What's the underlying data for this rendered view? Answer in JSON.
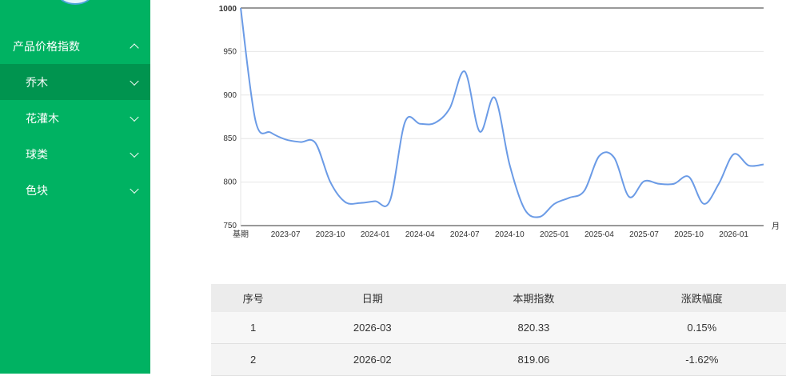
{
  "sidebar": {
    "top_item": "产品价格指数",
    "items": [
      {
        "label": "乔木"
      },
      {
        "label": "花灌木"
      },
      {
        "label": "球类"
      },
      {
        "label": "色块"
      }
    ]
  },
  "colors": {
    "sidebar_bg": "#00b262",
    "sidebar_active": "#00944f",
    "line": "#6b9be6"
  },
  "chart_data": {
    "type": "line",
    "y_ticks": [
      "1000",
      "950",
      "900",
      "850",
      "800",
      "750"
    ],
    "x_ticks": [
      "基期",
      "2023-07",
      "2023-10",
      "2024-01",
      "2024-04",
      "2024-07",
      "2024-10",
      "2025-01",
      "2025-04",
      "2025-07",
      "2025-10",
      "2026-01"
    ],
    "x_unit": "月",
    "ylim": [
      750,
      1000
    ],
    "grid": true,
    "series": [
      {
        "x": [
          "基期",
          "2023-05",
          "2023-06",
          "2023-07",
          "2023-08",
          "2023-09",
          "2023-10",
          "2023-11",
          "2023-12",
          "2024-01",
          "2024-02",
          "2024-03",
          "2024-04",
          "2024-05",
          "2024-06",
          "2024-07",
          "2024-08",
          "2024-09",
          "2024-10",
          "2024-11",
          "2024-12",
          "2025-01",
          "2025-02",
          "2025-03",
          "2025-04",
          "2025-05",
          "2025-06",
          "2025-07",
          "2025-08",
          "2025-09",
          "2025-10",
          "2025-11",
          "2025-12",
          "2026-01",
          "2026-02",
          "2026-03"
        ],
        "values": [
          1000,
          870,
          857,
          849,
          846,
          845,
          800,
          777,
          776,
          778,
          779,
          869,
          867,
          868,
          885,
          927,
          858,
          897,
          820,
          769,
          760,
          775,
          782,
          790,
          830,
          828,
          783,
          801,
          798,
          798,
          806,
          775,
          798,
          832,
          819,
          820.33
        ]
      }
    ]
  },
  "table": {
    "headers": [
      "序号",
      "日期",
      "本期指数",
      "涨跌幅度"
    ],
    "rows": [
      [
        "1",
        "2026-03",
        "820.33",
        "0.15%"
      ],
      [
        "2",
        "2026-02",
        "819.06",
        "-1.62%"
      ]
    ]
  }
}
